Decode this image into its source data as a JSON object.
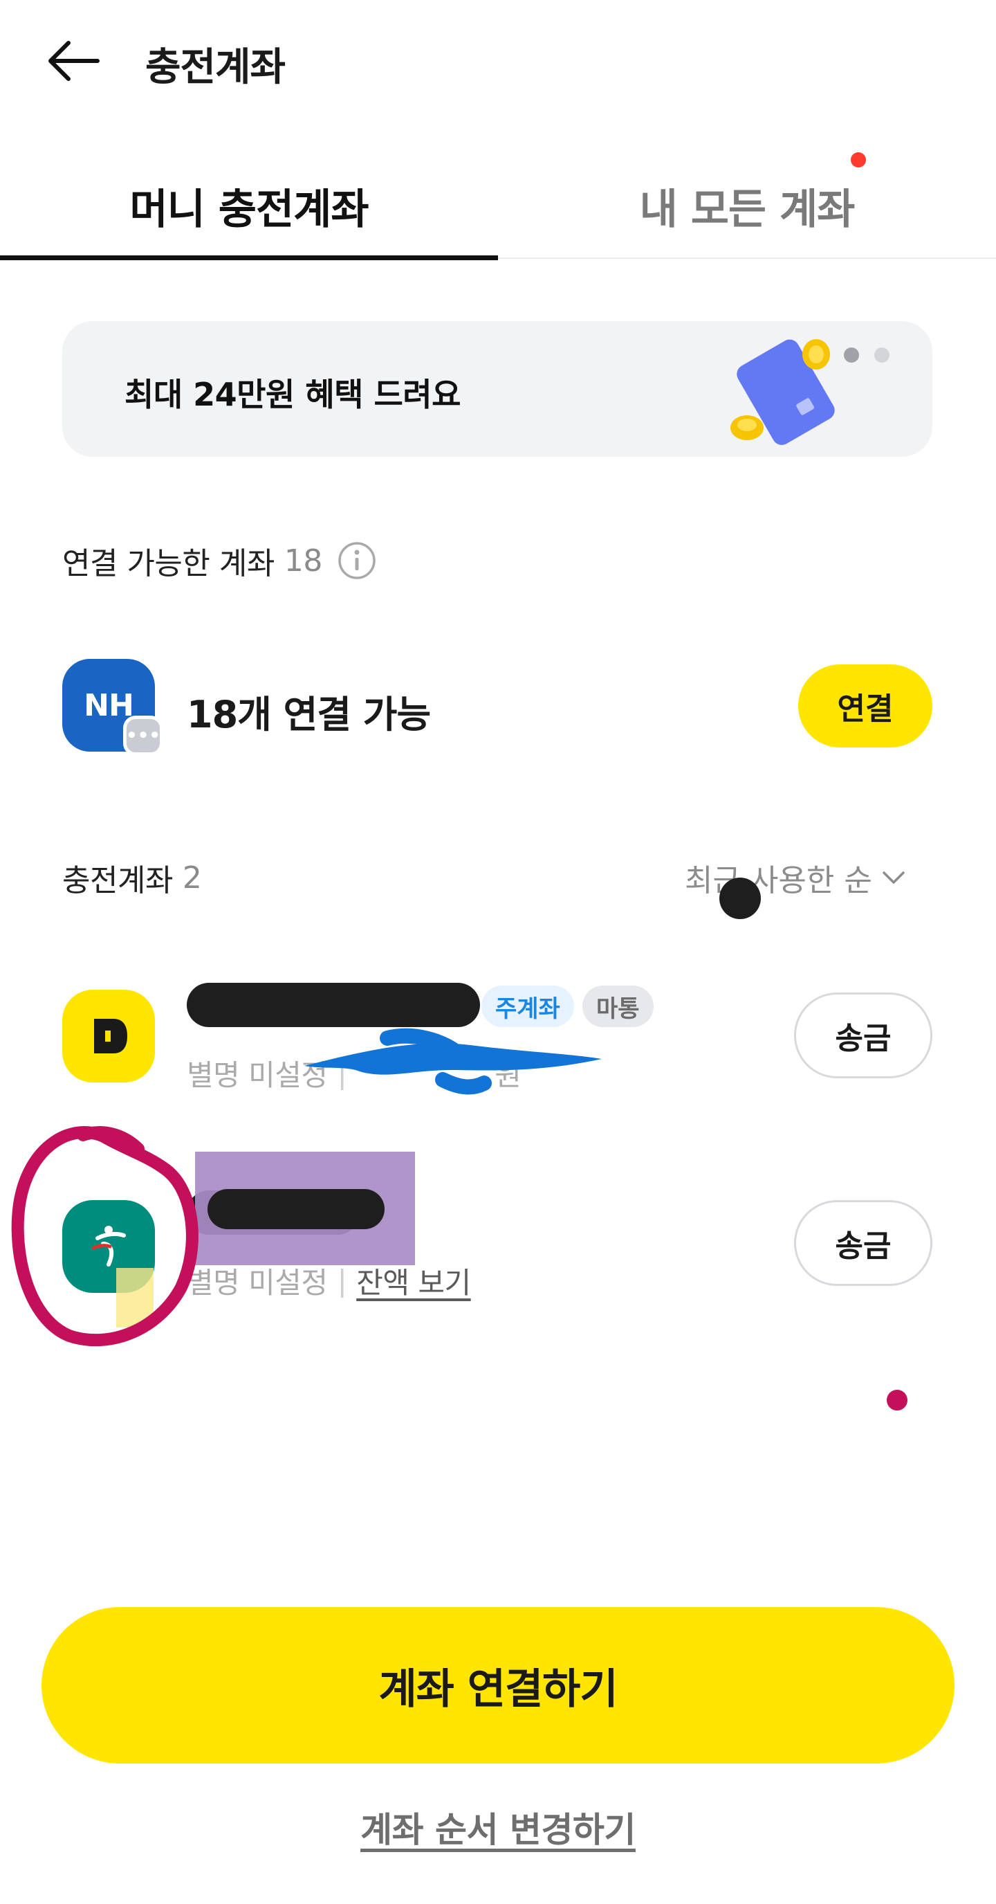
{
  "header": {
    "title": "충전계좌"
  },
  "tabs": [
    {
      "label": "머니 충전계좌",
      "active": true
    },
    {
      "label": "내 모든 계좌",
      "active": false,
      "has_badge": true
    }
  ],
  "banner": {
    "text": "최대 24만원 혜택 드려요",
    "page_count": 2,
    "active_page": 1
  },
  "connectable": {
    "heading": "연결 가능한 계좌",
    "count": "18",
    "bank_logo": "NH",
    "summary": "18개 연결 가능",
    "button": "연결"
  },
  "charge_accounts": {
    "heading": "충전계좌",
    "count": "2",
    "sort_label": "최근 사용한 순",
    "items": [
      {
        "logo": "kakaobank-b-icon",
        "tags": [
          "주계좌",
          "마통"
        ],
        "subtitle": "별명 미설정",
        "balance_suffix": "원",
        "action": "송금"
      },
      {
        "logo": "hana-bank-icon",
        "subtitle": "별명 미설정",
        "link": "잔액 보기",
        "action": "송금"
      }
    ]
  },
  "footer": {
    "primary_button": "계좌 연결하기",
    "secondary_link": "계좌 순서 변경하기"
  },
  "colors": {
    "accent_yellow": "#ffe500",
    "nh_blue": "#1a64c4",
    "hana_green": "#008d7d",
    "badge_red": "#ff3b30"
  }
}
